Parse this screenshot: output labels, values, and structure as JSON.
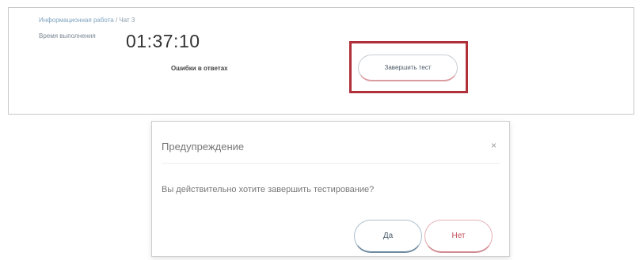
{
  "panel": {
    "breadcrumb_link": "Информационная работа",
    "breadcrumb_sep": " / ",
    "breadcrumb_current": "Чат 3",
    "time_label": "Время выполнения",
    "timer": "01:37:10",
    "error_link": "Ошибки в ответах",
    "finish_button": "Завершить тест",
    "highlight_color": "#b0303a"
  },
  "dialog": {
    "title": "Предупреждение",
    "close_glyph": "×",
    "message": "Вы действительно хотите завершить тестирование?",
    "yes_label": "Да",
    "no_label": "Нет"
  }
}
